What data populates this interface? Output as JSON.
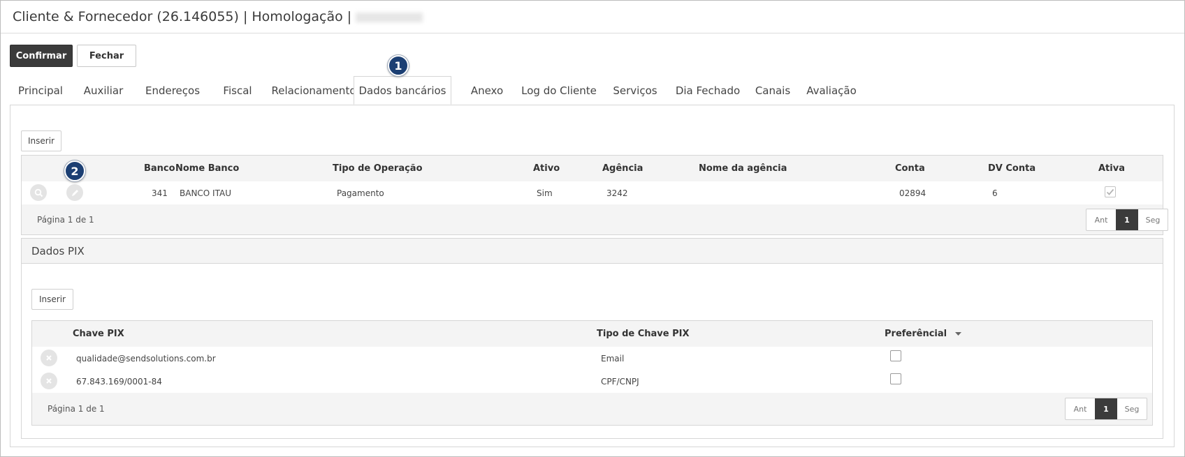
{
  "window": {
    "title": "Cliente & Fornecedor (26.146055) | Homologação |"
  },
  "toolbar": {
    "confirm_label": "Confirmar",
    "close_label": "Fechar"
  },
  "tabs": [
    {
      "label": "Principal"
    },
    {
      "label": "Auxiliar"
    },
    {
      "label": "Endereços"
    },
    {
      "label": "Fiscal"
    },
    {
      "label": "Relacionamento"
    },
    {
      "label": "Dados bancários",
      "active": true
    },
    {
      "label": "Anexo"
    },
    {
      "label": "Log do Cliente"
    },
    {
      "label": "Serviços"
    },
    {
      "label": "Dia Fechado"
    },
    {
      "label": "Canais"
    },
    {
      "label": "Avaliação"
    }
  ],
  "markers": [
    "1",
    "2"
  ],
  "bank_grid": {
    "insert_label": "Inserir",
    "columns": [
      "Banco",
      "Nome Banco",
      "Tipo de Operação",
      "Ativo",
      "Agência",
      "Nome da agência",
      "Conta",
      "DV Conta",
      "Ativa"
    ],
    "rows": [
      {
        "banco": "341",
        "nome_banco": "BANCO ITAU",
        "tipo_operacao": "Pagamento",
        "ativo": "Sim",
        "agencia": "3242",
        "nome_agencia": "",
        "conta": "02894",
        "dv_conta": "6",
        "ativa": true
      }
    ],
    "pagination": {
      "text": "Página 1 de 1",
      "prev": "Ant",
      "current": "1",
      "next": "Seg"
    }
  },
  "pix": {
    "section_title": "Dados PIX",
    "insert_label": "Inserir",
    "columns": [
      "Chave PIX",
      "Tipo de Chave PIX",
      "Preferêncial"
    ],
    "rows": [
      {
        "chave": "qualidade@sendsolutions.com.br",
        "tipo": "Email",
        "preferencial": false
      },
      {
        "chave": "67.843.169/0001-84",
        "tipo": "CPF/CNPJ",
        "preferencial": false
      }
    ],
    "pagination": {
      "text": "Página 1 de 1",
      "prev": "Ant",
      "current": "1",
      "next": "Seg"
    }
  }
}
